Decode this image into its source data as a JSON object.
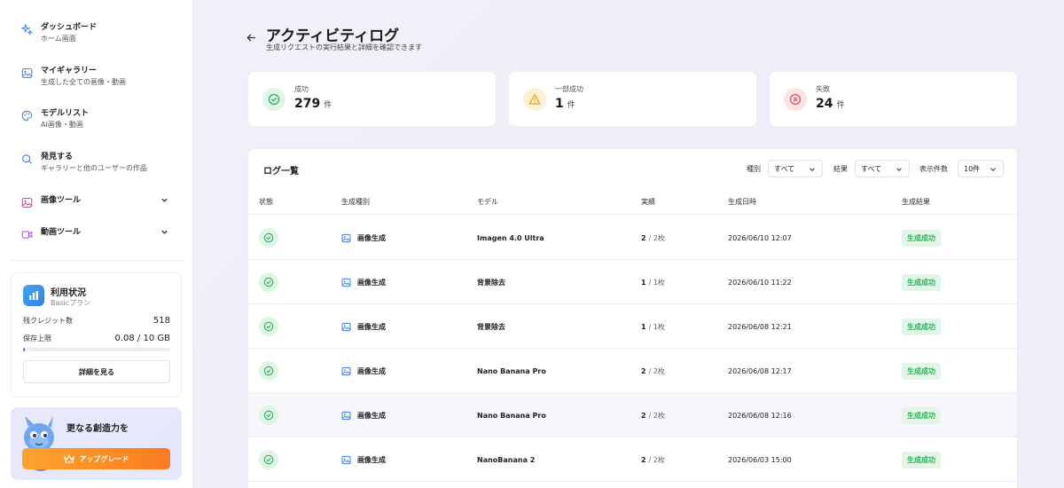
{
  "sidebar": {
    "items": [
      {
        "title": "ダッシュボード",
        "sub": "ホーム画面",
        "icon": "sparkle-icon"
      },
      {
        "title": "マイギャラリー",
        "sub": "生成した全ての画像・動画",
        "icon": "image-icon"
      },
      {
        "title": "モデルリスト",
        "sub": "AI画像・動画",
        "icon": "palette-icon"
      },
      {
        "title": "発見する",
        "sub": "ギャラリーと他のユーザーの作品",
        "icon": "search-icon"
      },
      {
        "title": "画像ツール",
        "icon": "image-tool-icon"
      },
      {
        "title": "動画ツール",
        "icon": "video-tool-icon"
      }
    ],
    "usage": {
      "title": "利用状況",
      "plan": "Basicプラン",
      "credits_label": "残クレジット数",
      "credits_value": "518",
      "storage_label": "保存上限",
      "storage_value": "0.08 / 10 GB",
      "storage_fraction": 0.008,
      "detail_button": "詳細を見る"
    },
    "upgrade": {
      "text": "更なる創造力を",
      "button": "アップグレード"
    }
  },
  "header": {
    "title": "アクティビティログ",
    "subtitle": "生成リクエストの実行結果と詳細を確認できます"
  },
  "stats": [
    {
      "label": "成功",
      "value": "279",
      "unit": "件",
      "icon": "check-circle-icon",
      "color": "#2bb05b",
      "bg": "#e2f6e7"
    },
    {
      "label": "一部成功",
      "value": "1",
      "unit": "件",
      "icon": "warning-icon",
      "color": "#e6a81a",
      "bg": "#fcf1d6"
    },
    {
      "label": "失敗",
      "value": "24",
      "unit": "件",
      "icon": "x-circle-icon",
      "color": "#e05a6a",
      "bg": "#fbe3e6"
    }
  ],
  "log": {
    "title": "ログ一覧",
    "filters": {
      "type_label": "種別",
      "type_value": "すべて",
      "result_label": "結果",
      "result_value": "すべて",
      "count_label": "表示件数",
      "count_value": "10件"
    },
    "columns": [
      "状態",
      "生成種別",
      "モデル",
      "実績",
      "生成日時",
      "生成結果"
    ],
    "rows": [
      {
        "type": "画像生成",
        "model": "Imagen 4.0 Ultra",
        "done": "2",
        "total": "/ 2枚",
        "datetime": "2026/06/10 12:07",
        "result": "生成成功"
      },
      {
        "type": "画像生成",
        "model": "背景除去",
        "done": "1",
        "total": "/ 1枚",
        "datetime": "2026/06/10 11:22",
        "result": "生成成功"
      },
      {
        "type": "画像生成",
        "model": "背景除去",
        "done": "1",
        "total": "/ 1枚",
        "datetime": "2026/06/08 12:21",
        "result": "生成成功"
      },
      {
        "type": "画像生成",
        "model": "Nano Banana Pro",
        "done": "2",
        "total": "/ 2枚",
        "datetime": "2026/06/08 12:17",
        "result": "生成成功"
      },
      {
        "type": "画像生成",
        "model": "Nano Banana Pro",
        "done": "2",
        "total": "/ 2枚",
        "datetime": "2026/06/08 12:16",
        "result": "生成成功"
      },
      {
        "type": "画像生成",
        "model": "NanoBanana 2",
        "done": "2",
        "total": "/ 2枚",
        "datetime": "2026/06/03 15:00",
        "result": "生成成功"
      }
    ]
  }
}
